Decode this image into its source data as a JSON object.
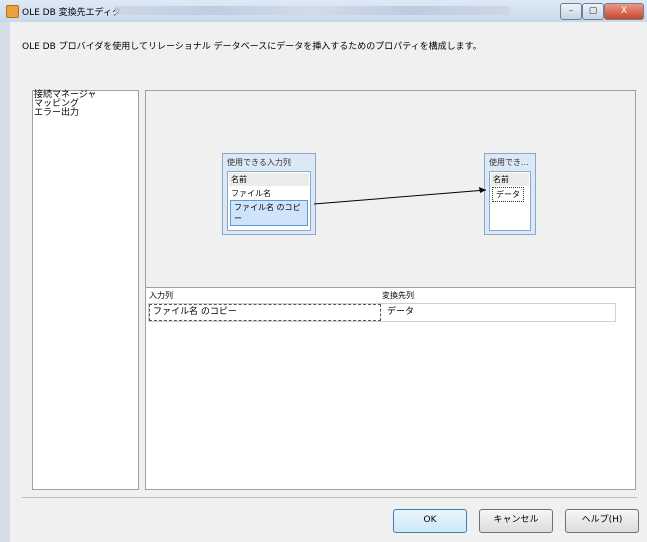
{
  "window": {
    "title": "OLE DB 変換先エディタ",
    "controls": [
      "–",
      "▢",
      "X"
    ]
  },
  "description": "OLE DB プロバイダを使用してリレーショナル データベースにデータを挿入するためのプロパティを構成します。",
  "nav": {
    "items": [
      {
        "label": "接続マネージャ"
      },
      {
        "label": "マッピング"
      },
      {
        "label": "エラー出力"
      }
    ]
  },
  "mapping": {
    "input_box": {
      "title": "使用できる入力列",
      "header": "名前",
      "rows": [
        "ファイル名",
        "ファイル名 のコピー"
      ]
    },
    "dest_box": {
      "title": "使用でき...",
      "header": "名前",
      "rows": [
        "データ"
      ]
    }
  },
  "grid": {
    "columns": [
      "入力列",
      "変換先列"
    ],
    "rows": [
      {
        "input": "ファイル名 のコピー",
        "dest": "データ"
      }
    ]
  },
  "buttons": {
    "ok": "OK",
    "cancel": "キャンセル",
    "help": "ヘルプ(H)"
  }
}
